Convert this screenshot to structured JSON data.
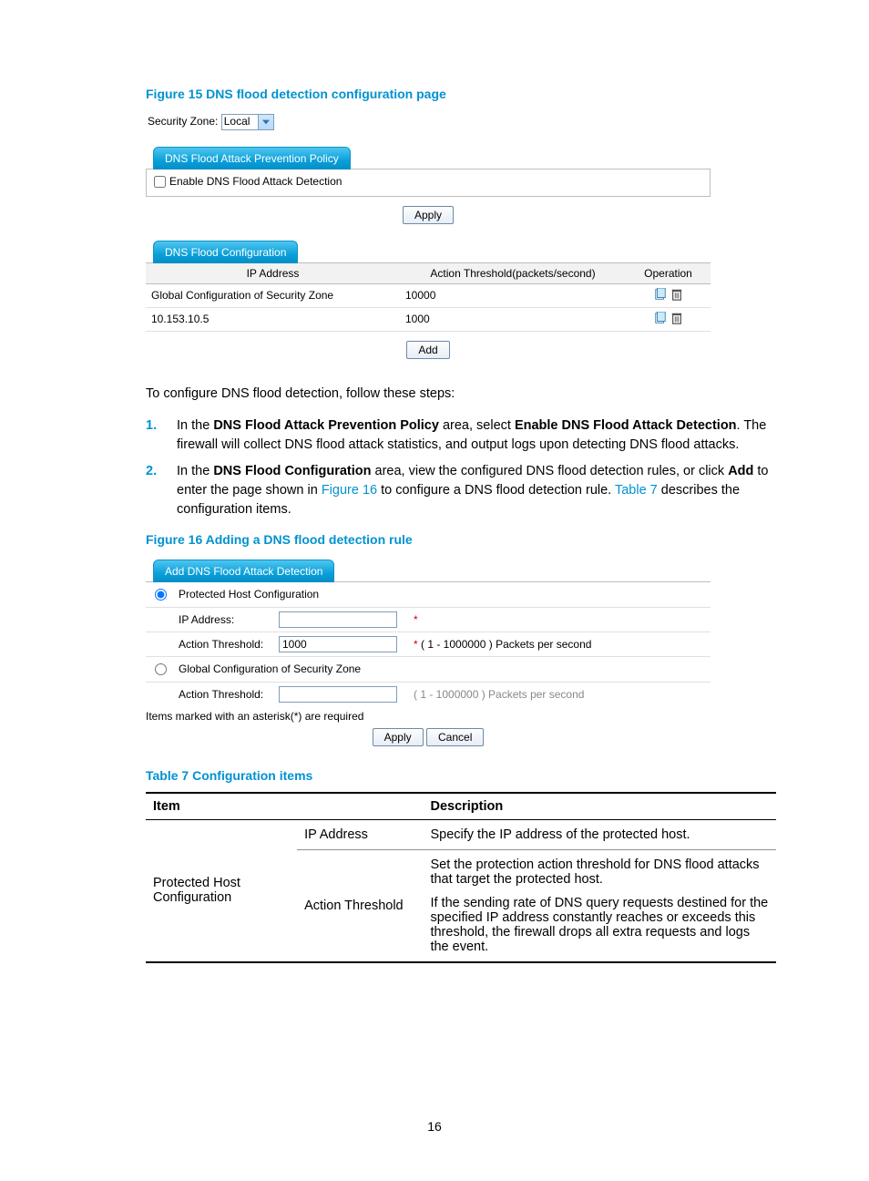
{
  "figure15": {
    "caption": "Figure 15 DNS flood detection configuration page",
    "security_zone_label": "Security Zone:",
    "security_zone_value": "Local",
    "policy_tab": "DNS Flood Attack Prevention Policy",
    "enable_label": "Enable DNS Flood Attack Detection",
    "apply": "Apply",
    "config_tab": "DNS Flood Configuration",
    "cols": {
      "ip": "IP Address",
      "thr": "Action Threshold(packets/second)",
      "op": "Operation"
    },
    "rows": [
      {
        "ip": "Global Configuration of Security Zone",
        "thr": "10000"
      },
      {
        "ip": "10.153.10.5",
        "thr": "1000"
      }
    ],
    "add": "Add"
  },
  "body": {
    "intro": "To configure DNS flood detection, follow these steps:",
    "step1_a": "In the ",
    "step1_b": "DNS Flood Attack Prevention Policy",
    "step1_c": " area, select ",
    "step1_d": "Enable DNS Flood Attack Detection",
    "step1_e": ". The firewall will collect DNS flood attack statistics, and output logs upon detecting DNS flood attacks.",
    "step2_a": "In the ",
    "step2_b": "DNS Flood Configuration",
    "step2_c": " area, view the configured DNS flood detection rules, or click ",
    "step2_d": "Add",
    "step2_e": " to enter the page shown in ",
    "step2_link1": "Figure 16",
    "step2_f": " to configure a DNS flood detection rule. ",
    "step2_link2": "Table 7",
    "step2_g": " describes the configuration items.",
    "num1": "1.",
    "num2": "2."
  },
  "figure16": {
    "caption": "Figure 16 Adding a DNS flood detection rule",
    "tab": "Add DNS Flood Attack Detection",
    "opt_host": "Protected Host Configuration",
    "ip_label": "IP Address:",
    "ip_req": "*",
    "thr_label": "Action Threshold:",
    "thr_value": "1000",
    "thr_hint": "( 1 - 1000000 ) Packets per second",
    "opt_global": "Global Configuration of Security Zone",
    "global_thr_label": "Action Threshold:",
    "global_thr_hint": "( 1 - 1000000 ) Packets per second",
    "ast_note": "Items marked with an asterisk(*) are required",
    "apply": "Apply",
    "cancel": "Cancel"
  },
  "table7": {
    "caption": "Table 7 Configuration items",
    "head_item": "Item",
    "head_desc": "Description",
    "row_group": "Protected Host Configuration",
    "r1_item": "IP Address",
    "r1_desc": "Specify the IP address of the protected host.",
    "r2_item": "Action Threshold",
    "r2_p1": "Set the protection action threshold for DNS flood attacks that target the protected host.",
    "r2_p2": "If the sending rate of DNS query requests destined for the specified IP address constantly reaches or exceeds this threshold, the firewall drops all extra requests and logs the event."
  },
  "page_number": "16"
}
